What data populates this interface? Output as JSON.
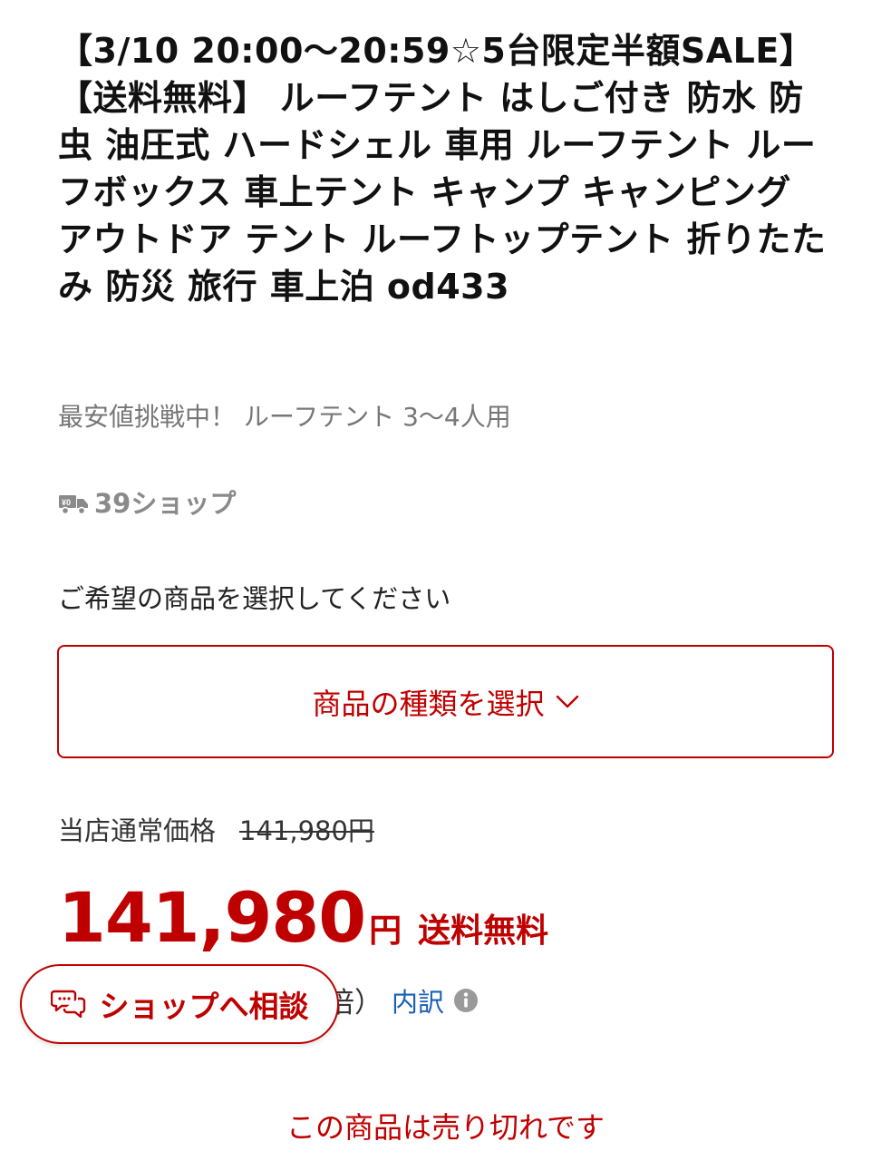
{
  "product": {
    "title": "【3/10 20:00〜20:59☆5台限定半額SALE】【送料無料】 ルーフテント はしご付き 防水 防虫 油圧式 ハードシェル 車用 ルーフテント ルーフボックス 車上テント キャンプ キャンピング アウトドア テント ルーフトップテント 折りたたみ 防災 旅行 車上泊 od433",
    "catch_copy": "最安値挑戦中！ ルーフテント 3〜4人用"
  },
  "shop": {
    "icon": "truck-icon",
    "name": "39ショップ"
  },
  "variant_select": {
    "label": "ご希望の商品を選択してください",
    "button_label": "商品の種類を選択",
    "icon": "chevron-down-icon"
  },
  "pricing": {
    "normal_label": "当店通常価格",
    "normal_price": "141,980円",
    "price": "141,980",
    "currency": "円",
    "shipping": "送料無料",
    "points_fragment": "倍）",
    "breakdown_link": "内訳",
    "info_icon": "info-icon"
  },
  "consult_button": {
    "label": "ショップへ相談",
    "icon": "chat-bubbles-icon"
  },
  "status": {
    "sold_out": "この商品は売り切れです"
  },
  "colors": {
    "accent": "#bf0000",
    "link": "#1a5fb4",
    "muted": "#777777"
  }
}
